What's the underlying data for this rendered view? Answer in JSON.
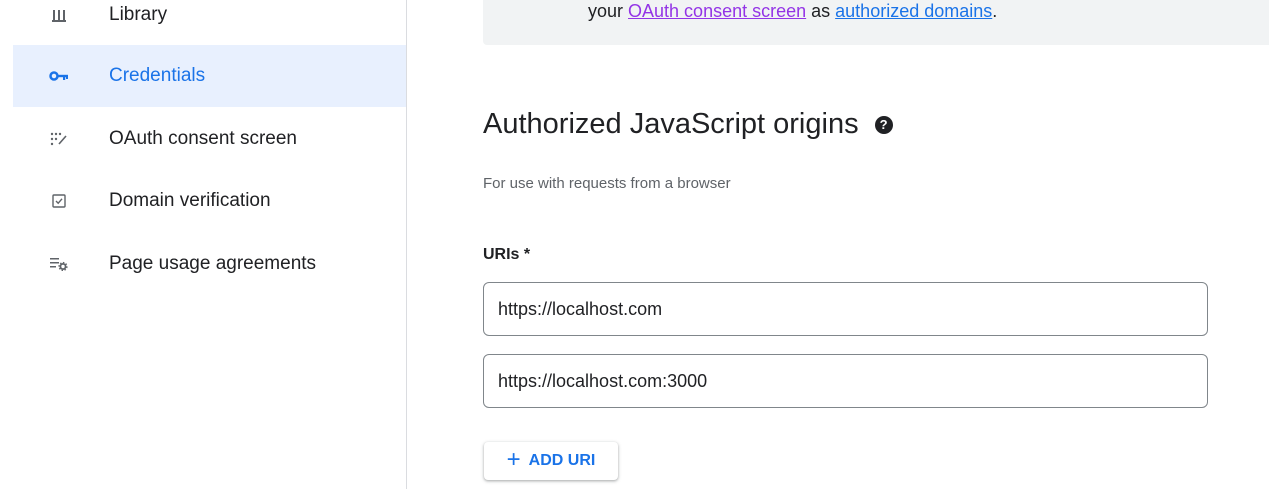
{
  "sidebar": {
    "items": [
      {
        "label": "Library",
        "icon": "library-icon",
        "active": false
      },
      {
        "label": "Credentials",
        "icon": "key-icon",
        "active": true
      },
      {
        "label": "OAuth consent screen",
        "icon": "consent-icon",
        "active": false
      },
      {
        "label": "Domain verification",
        "icon": "checkbox-icon",
        "active": false
      },
      {
        "label": "Page usage agreements",
        "icon": "list-settings-icon",
        "active": false
      }
    ]
  },
  "notice": {
    "prefix": "your ",
    "link1": "OAuth consent screen",
    "middle": " as ",
    "link2": "authorized domains",
    "suffix": "."
  },
  "origins": {
    "title": "Authorized JavaScript origins",
    "description": "For use with requests from a browser",
    "uris_label": "URIs *",
    "uris": [
      "https://localhost.com",
      "https://localhost.com:3000"
    ],
    "add_button": "ADD URI"
  },
  "colors": {
    "accent": "#1a73e8",
    "active_bg": "#e8f0fe",
    "visited_link": "#9334e6"
  }
}
